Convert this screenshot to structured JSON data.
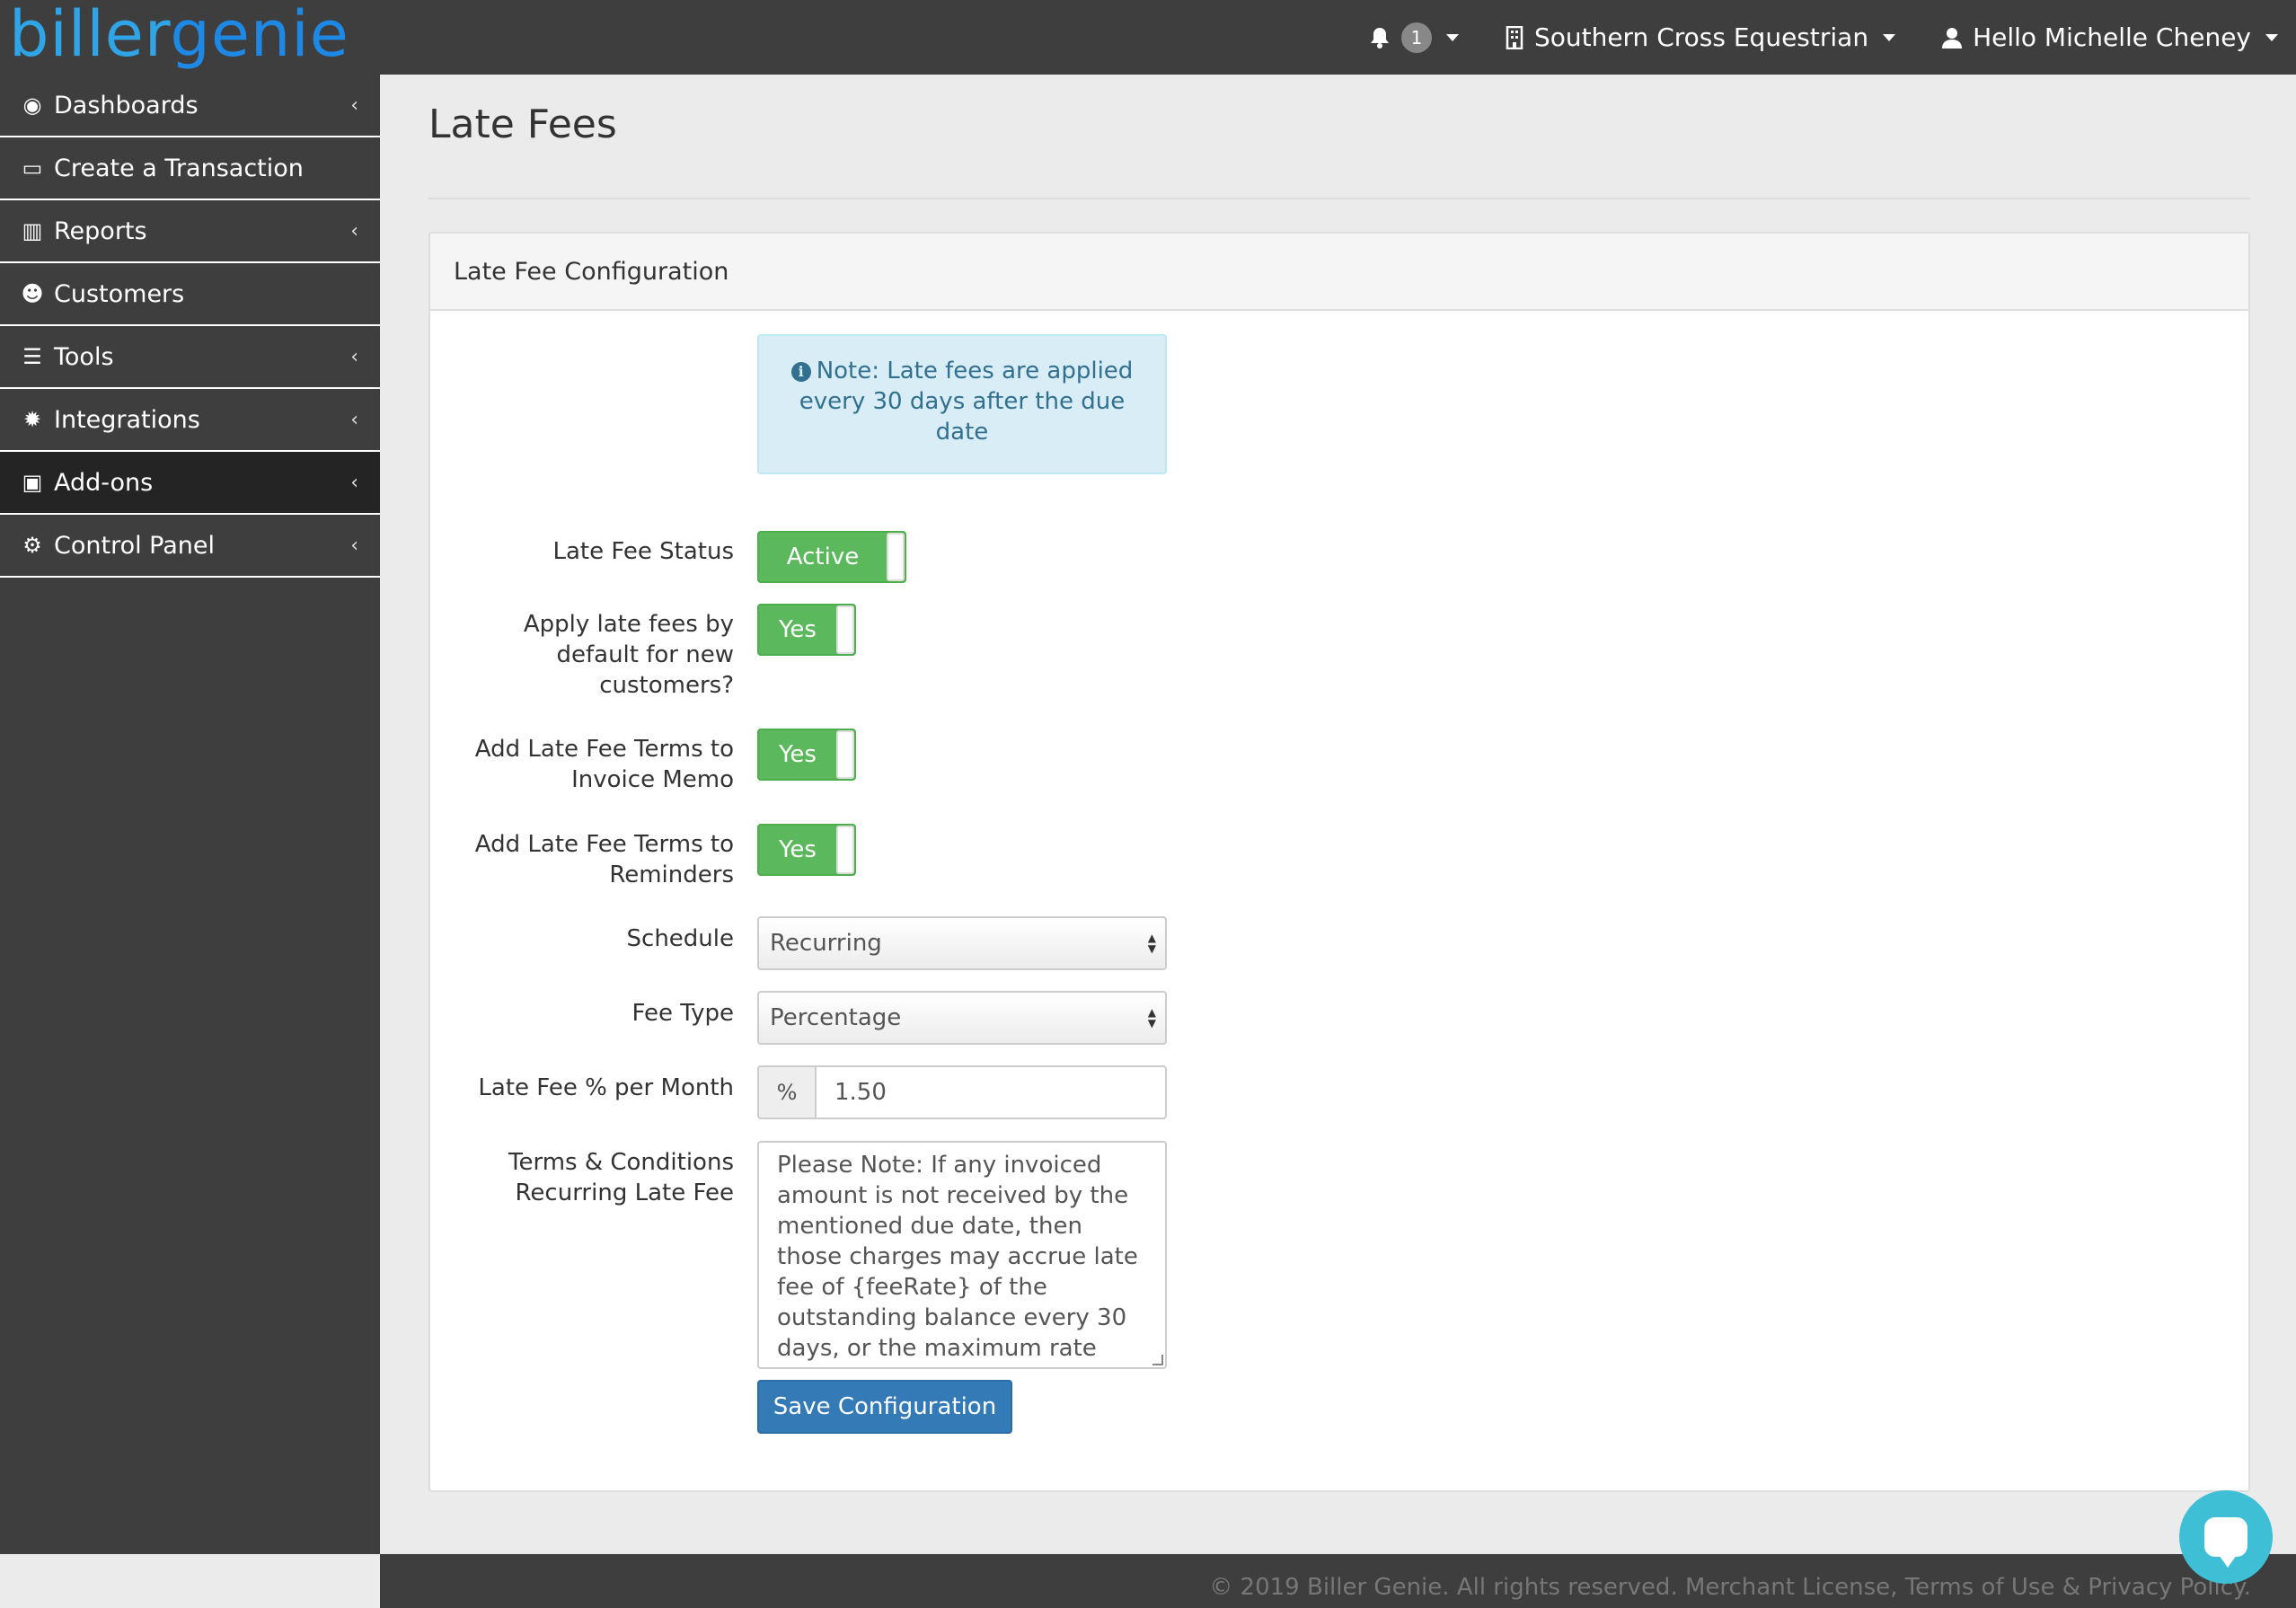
{
  "brand": {
    "part1": "biller",
    "part2": "genie"
  },
  "topbar": {
    "notification_count": "1",
    "company": "Southern Cross Equestrian",
    "user_greeting": "Hello Michelle Cheney"
  },
  "sidebar": {
    "items": [
      {
        "label": "Dashboards",
        "icon": "dashboard-icon",
        "glyph": "◉",
        "has_chevron": true
      },
      {
        "label": "Create a Transaction",
        "icon": "credit-card-icon",
        "glyph": "▭",
        "has_chevron": false
      },
      {
        "label": "Reports",
        "icon": "bar-chart-icon",
        "glyph": "▥",
        "has_chevron": true
      },
      {
        "label": "Customers",
        "icon": "users-icon",
        "glyph": "☻",
        "has_chevron": false
      },
      {
        "label": "Tools",
        "icon": "sliders-icon",
        "glyph": "☰",
        "has_chevron": true
      },
      {
        "label": "Integrations",
        "icon": "gear-icon",
        "glyph": "✹",
        "has_chevron": true
      },
      {
        "label": "Add-ons",
        "icon": "image-icon",
        "glyph": "▣",
        "has_chevron": true
      },
      {
        "label": "Control Panel",
        "icon": "cogs-icon",
        "glyph": "⚙",
        "has_chevron": true
      }
    ],
    "active_index": 6,
    "chevron_glyph": "‹"
  },
  "page": {
    "title": "Late Fees"
  },
  "panel": {
    "heading": "Late Fee Configuration",
    "note": "Note: Late fees are applied every 30 days after the due date",
    "fields": {
      "status_label": "Late Fee Status",
      "status_value": "Active",
      "apply_default_label": "Apply late fees by default for new customers?",
      "apply_default_value": "Yes",
      "invoice_memo_label": "Add Late Fee Terms to Invoice Memo",
      "invoice_memo_value": "Yes",
      "reminders_label": "Add Late Fee Terms to Reminders",
      "reminders_value": "Yes",
      "schedule_label": "Schedule",
      "schedule_value": "Recurring",
      "fee_type_label": "Fee Type",
      "fee_type_value": "Percentage",
      "rate_label": "Late Fee % per Month",
      "rate_addon": "%",
      "rate_value": "1.50",
      "terms_label": "Terms & Conditions Recurring Late Fee",
      "terms_value": "Please Note: If any invoiced amount is not received by the mentioned due date, then those charges may accrue late fee of {feeRate} of the outstanding balance every 30 days, or the maximum rate permitted by the"
    },
    "save_label": "Save Configuration"
  },
  "footer": {
    "text": "© 2019 Biller Genie. All rights reserved. Merchant License, Terms of Use & Privacy Policy."
  },
  "colors": {
    "toggle_on": "#5cb85c",
    "primary": "#337ab7",
    "brand": "#2fa4e7",
    "chrome": "#3e3e3e"
  }
}
